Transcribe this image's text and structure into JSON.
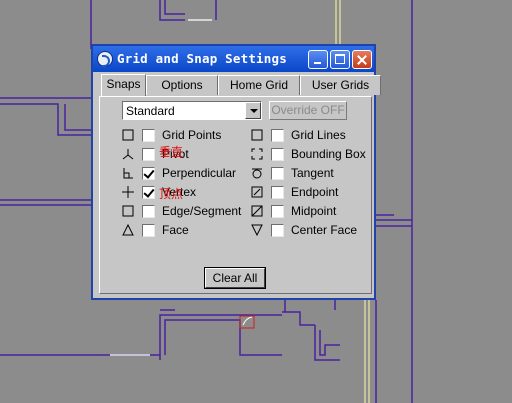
{
  "dialog": {
    "title": "Grid and Snap Settings",
    "tabs": [
      "Snaps",
      "Options",
      "Home Grid",
      "User Grids"
    ],
    "active_tab": "Snaps",
    "snap_set": "Standard",
    "override_label": "Override OFF",
    "clear_all_label": "Clear All",
    "left_snaps": [
      {
        "label": "Grid Points",
        "checked": false,
        "icon": "grid-points-icon"
      },
      {
        "label": "Pivot",
        "checked": false,
        "icon": "pivot-icon",
        "note": "垂直"
      },
      {
        "label": "Perpendicular",
        "checked": true,
        "icon": "perpendicular-icon"
      },
      {
        "label": "Vertex",
        "checked": true,
        "icon": "vertex-icon",
        "note": "顶点"
      },
      {
        "label": "Edge/Segment",
        "checked": false,
        "icon": "edge-segment-icon"
      },
      {
        "label": "Face",
        "checked": false,
        "icon": "face-icon"
      }
    ],
    "right_snaps": [
      {
        "label": "Grid Lines",
        "checked": false,
        "icon": "grid-lines-icon"
      },
      {
        "label": "Bounding Box",
        "checked": false,
        "icon": "bounding-box-icon"
      },
      {
        "label": "Tangent",
        "checked": false,
        "icon": "tangent-icon"
      },
      {
        "label": "Endpoint",
        "checked": false,
        "icon": "endpoint-icon"
      },
      {
        "label": "Midpoint",
        "checked": false,
        "icon": "midpoint-icon"
      },
      {
        "label": "Center Face",
        "checked": false,
        "icon": "center-face-icon"
      }
    ]
  },
  "colors": {
    "viewport_bg": "#8c8c8c",
    "drawing_lines": "#5a2fa0",
    "dialog_bg": "#c6c6c6",
    "titlebar": "#0a47c8",
    "annotation": "#e01010"
  }
}
